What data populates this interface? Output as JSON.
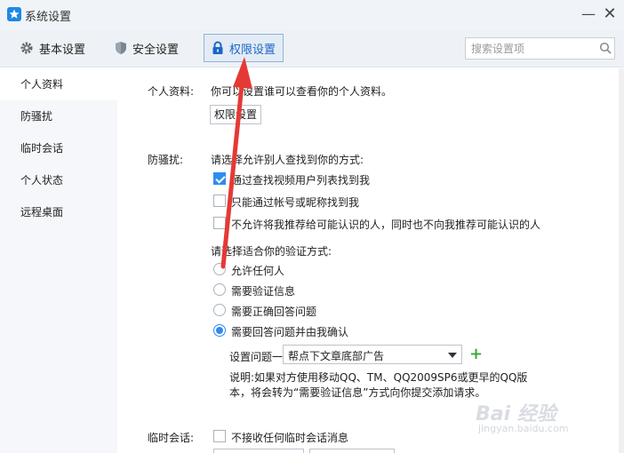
{
  "window": {
    "title": "系统设置",
    "minimize": "—",
    "close": "✕"
  },
  "tabs": [
    {
      "label": "基本设置",
      "icon": "gear-icon"
    },
    {
      "label": "安全设置",
      "icon": "shield-icon"
    },
    {
      "label": "权限设置",
      "icon": "lock-icon",
      "selected": true
    }
  ],
  "search": {
    "placeholder": "搜索设置项",
    "value": ""
  },
  "sidebar": {
    "items": [
      {
        "label": "个人资料",
        "selected": true
      },
      {
        "label": "防骚扰"
      },
      {
        "label": "临时会话"
      },
      {
        "label": "个人状态"
      },
      {
        "label": "远程桌面"
      }
    ]
  },
  "profile": {
    "label": "个人资料:",
    "desc": "你可以设置谁可以查看你的个人资料。",
    "button": "权限设置"
  },
  "anti_harass": {
    "label": "防骚扰:",
    "find_prompt": "请选择允许别人查找到你的方式:",
    "options": [
      {
        "label": "通过查找视频用户列表找到我",
        "checked": true
      },
      {
        "label": "只能通过帐号或昵称找到我",
        "checked": false
      },
      {
        "label": "不允许将我推荐给可能认识的人，同时也不向我推荐可能认识的人",
        "checked": false
      }
    ],
    "verify_prompt": "请选择适合你的验证方式:",
    "verify_options": [
      {
        "label": "允许任何人",
        "checked": false
      },
      {
        "label": "需要验证信息",
        "checked": false
      },
      {
        "label": "需要正确回答问题",
        "checked": false
      },
      {
        "label": "需要回答问题并由我确认",
        "checked": true
      }
    ],
    "question_label": "设置问题一:",
    "question_value": "帮点下文章底部广告",
    "note_line1": "说明:如果对方使用移动QQ、TM、QQ2009SP6或更早的QQ版",
    "note_line2": "本，将会转为“需要验证信息”方式向你提交添加请求。"
  },
  "temp_chat": {
    "label": "临时会话:",
    "option": "不接收任何临时会话消息",
    "checked": false
  },
  "watermark": {
    "text": "Bai 经验",
    "sub": "jingyan.baidu.com"
  },
  "colors": {
    "accent": "#2d8cf0",
    "arrow": "#e53935",
    "tab_selected": "#1b66c9"
  }
}
